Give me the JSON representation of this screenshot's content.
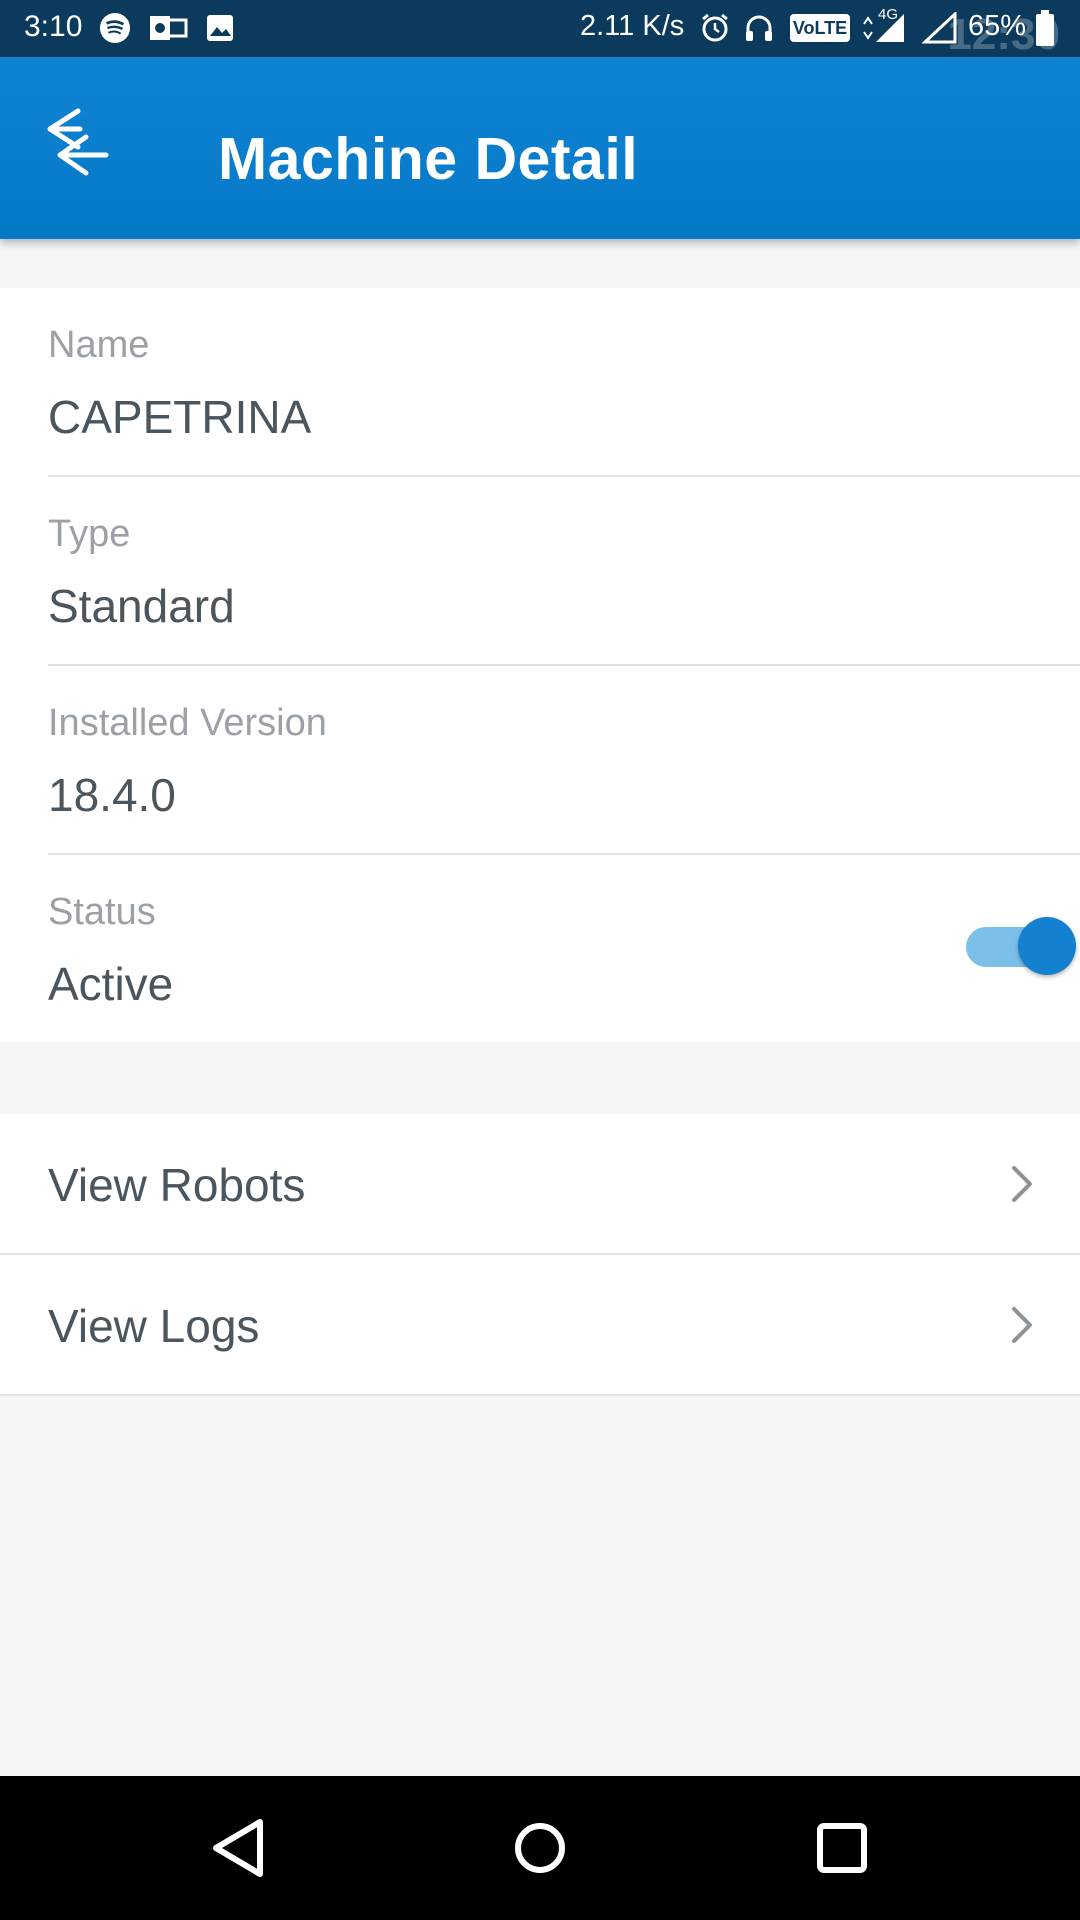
{
  "status_bar": {
    "time": "3:10",
    "net_speed": "2.11 K/s",
    "volte": "VoLTE",
    "network": "4G",
    "battery": "65%",
    "ghost_time": "12:30"
  },
  "app_bar": {
    "title": "Machine Detail",
    "back_icon": "back-arrow-icon",
    "color": "#0a7dcc"
  },
  "details": {
    "name": {
      "label": "Name",
      "value": "CAPETRINA"
    },
    "type": {
      "label": "Type",
      "value": "Standard"
    },
    "installed_version": {
      "label": "Installed Version",
      "value": "18.4.0"
    },
    "status": {
      "label": "Status",
      "value": "Active",
      "toggle_on": true
    }
  },
  "actions": [
    {
      "label": "View Robots",
      "icon": "chevron-right-icon"
    },
    {
      "label": "View Logs",
      "icon": "chevron-right-icon"
    }
  ],
  "nav_bar": {
    "buttons": [
      "back-triangle-icon",
      "home-circle-icon",
      "recents-square-icon"
    ]
  }
}
